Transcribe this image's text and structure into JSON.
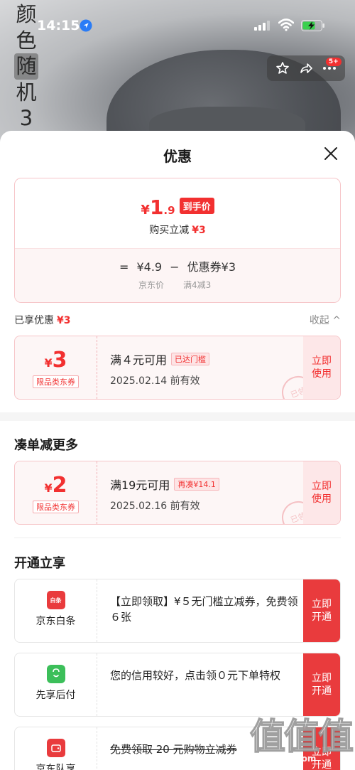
{
  "status_bar": {
    "time": "14:15"
  },
  "product": {
    "title_chars": [
      "颜",
      "色",
      "随",
      "机",
      "3"
    ],
    "cart_badge": "5+"
  },
  "sheet": {
    "title": "优惠",
    "price": {
      "currency": "¥",
      "final_int": "1",
      "final_dec": ".9",
      "final_tag": "到手价",
      "reduce_label": "购买立减",
      "reduce_amount": "¥3",
      "eq": "=",
      "original": "¥4.9",
      "minus": "−",
      "coupon_part": "优惠券¥3",
      "original_label": "京东价",
      "coupon_label": "满4减3"
    },
    "enjoyed": {
      "label": "已享优惠",
      "amount": "¥3",
      "collapse": "收起 ^"
    },
    "coupon1": {
      "currency": "¥",
      "value": "3",
      "kind": "限品类东券",
      "condition": "满４元可用",
      "flag": "已达门槛",
      "expiry": "2025.02.14 前有效",
      "action": "立即\n使用",
      "stamp": "已领"
    },
    "more_title": "凑单减更多",
    "coupon2": {
      "currency": "¥",
      "value": "2",
      "kind": "限品类东券",
      "condition": "满19元可用",
      "flag": "再凑¥14.1",
      "expiry": "2025.02.16 前有效",
      "action": "立即\n使用",
      "stamp": "已领"
    },
    "open_title": "开通立享",
    "open_items": [
      {
        "name": "京东白条",
        "logo_text": "白条",
        "desc": "【立即领取】¥５无门槛立减券，免费领６张",
        "action": "立即\n开通"
      },
      {
        "name": "先享后付",
        "desc": "您的信用较好，点击领０元下单特权",
        "action": "立即\n开通"
      },
      {
        "name": "京东队享",
        "desc": "免费领取 20 元购物立减券",
        "action": "立即\n开通"
      }
    ]
  },
  "watermark": {
    "big": "值值值",
    "small": "zhizhizhi.com"
  },
  "colors": {
    "accent": "#f23030",
    "button_red": "#e93b3d",
    "coupon_bg": "#fdf6f6"
  }
}
